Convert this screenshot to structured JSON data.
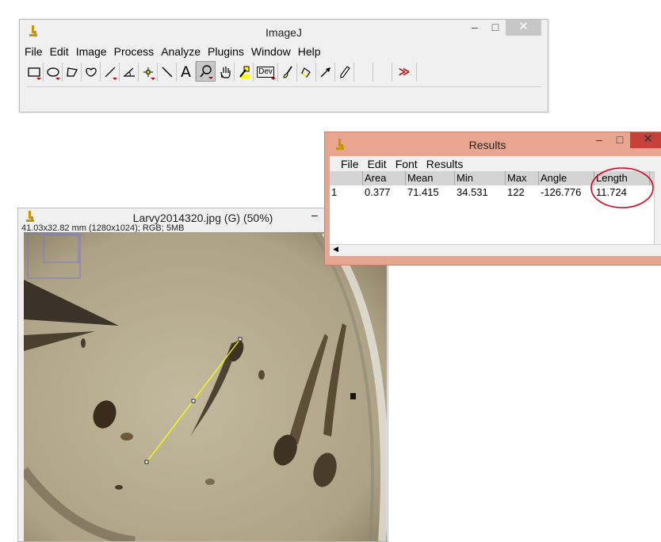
{
  "imagej": {
    "title": "ImageJ",
    "menus": [
      "File",
      "Edit",
      "Image",
      "Process",
      "Analyze",
      "Plugins",
      "Window",
      "Help"
    ],
    "tools": [
      {
        "name": "rectangle-tool-icon",
        "dropdown": true
      },
      {
        "name": "oval-tool-icon",
        "dropdown": true
      },
      {
        "name": "polygon-tool-icon",
        "dropdown": false
      },
      {
        "name": "freehand-tool-icon",
        "dropdown": false
      },
      {
        "name": "line-tool-icon",
        "dropdown": true
      },
      {
        "name": "angle-tool-icon",
        "dropdown": false
      },
      {
        "name": "point-tool-icon",
        "dropdown": true
      },
      {
        "name": "wand-tool-icon",
        "dropdown": false
      },
      {
        "name": "text-tool-icon",
        "dropdown": false
      },
      {
        "name": "magnifier-tool-icon",
        "dropdown": true
      },
      {
        "name": "hand-tool-icon",
        "dropdown": false
      },
      {
        "name": "color-picker-icon",
        "dropdown": false
      },
      {
        "name": "dev-tool-icon",
        "dropdown": true
      },
      {
        "name": "brush-tool-icon",
        "dropdown": false
      },
      {
        "name": "flood-fill-icon",
        "dropdown": false
      },
      {
        "name": "arrow-tool-icon",
        "dropdown": false
      },
      {
        "name": "pencil-tool-icon",
        "dropdown": false
      },
      {
        "name": "empty-tool-slot",
        "dropdown": false
      },
      {
        "name": "empty-tool-slot",
        "dropdown": false
      },
      {
        "name": "more-tools-icon",
        "dropdown": false
      }
    ],
    "text_tool_glyph": "A",
    "dev_label": "Dev",
    "more_glyph": "≫"
  },
  "results": {
    "title": "Results",
    "menus": [
      "File",
      "Edit",
      "Font",
      "Results"
    ],
    "columns": [
      "",
      "Area",
      "Mean",
      "Min",
      "Max",
      "Angle",
      "Length"
    ],
    "rows": [
      [
        "1",
        "0.377",
        "71.415",
        "34.531",
        "122",
        "-126.776",
        "11.724"
      ]
    ],
    "highlight_color": "#d6001c"
  },
  "image_window": {
    "title": "Larvy2014320.jpg (G) (50%)",
    "info": "41.03x32.82 mm (1280x1024); RGB; 5MB"
  },
  "window_controls": {
    "minimize": "–",
    "maximize": "□",
    "close": "✕"
  },
  "colors": {
    "results_titlebar": "#e8a590",
    "selection_line": "#ffff00",
    "plate_background": "#b2a78f"
  }
}
